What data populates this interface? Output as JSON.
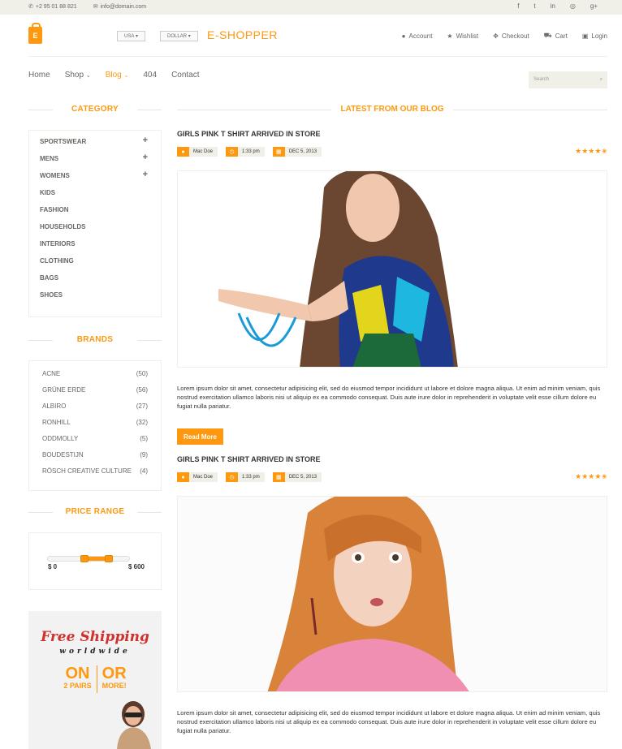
{
  "topbar": {
    "phone": "+2 95 01 88 821",
    "email": "info@domain.com",
    "social": [
      "f",
      "t",
      "in",
      "◎",
      "g+"
    ]
  },
  "header": {
    "logo": "E-SHOPPER",
    "country": "USA",
    "currency": "DOLLAR",
    "account": [
      "Account",
      "Wishlist",
      "Checkout",
      "Cart",
      "Login"
    ]
  },
  "nav": {
    "items": [
      "Home",
      "Shop",
      "Blog",
      "404",
      "Contact"
    ],
    "search_placeholder": "Search"
  },
  "sidebar": {
    "category_title": "CATEGORY",
    "categories": [
      {
        "label": "SPORTSWEAR",
        "expand": "+"
      },
      {
        "label": "MENS",
        "expand": "+"
      },
      {
        "label": "WOMENS",
        "expand": "+"
      },
      {
        "label": "KIDS"
      },
      {
        "label": "FASHION"
      },
      {
        "label": "HOUSEHOLDS"
      },
      {
        "label": "INTERIORS"
      },
      {
        "label": "CLOTHING"
      },
      {
        "label": "BAGS"
      },
      {
        "label": "SHOES"
      }
    ],
    "brands_title": "BRANDS",
    "brands": [
      {
        "name": "ACNE",
        "count": "(50)"
      },
      {
        "name": "GRÜNE ERDE",
        "count": "(56)"
      },
      {
        "name": "ALBIRO",
        "count": "(27)"
      },
      {
        "name": "RONHILL",
        "count": "(32)"
      },
      {
        "name": "ODDMOLLY",
        "count": "(5)"
      },
      {
        "name": "BOUDESTIJN",
        "count": "(9)"
      },
      {
        "name": "RÖSCH CREATIVE CULTURE",
        "count": "(4)"
      }
    ],
    "price_title": "PRICE RANGE",
    "price_min": "$ 0",
    "price_max": "$ 600",
    "ad": {
      "line1": "Free Shipping",
      "line2": "worldwide",
      "on": "ON",
      "pairs": "2 PAIRS",
      "or": "OR",
      "more": "MORE!"
    }
  },
  "main": {
    "title": "LATEST FROM OUR BLOG",
    "posts": [
      {
        "title": "GIRLS PINK T SHIRT ARRIVED IN STORE",
        "author": "Mac Doe",
        "time": "1:33 pm",
        "date": "DEC 5, 2013",
        "stars": "★★★★✬",
        "body": "Lorem ipsum dolor sit amet, consectetur adipisicing elit, sed do eiusmod tempor incididunt ut labore et dolore magna aliqua. Ut enim ad minim veniam, quis nostrud exercitation ullamco laboris nisi ut aliquip ex ea commodo consequat. Duis aute irure dolor in reprehenderit in voluptate velit esse cillum dolore eu fugiat nulla pariatur.",
        "read_more": "Read More"
      },
      {
        "title": "GIRLS PINK T SHIRT ARRIVED IN STORE",
        "author": "Mac Doe",
        "time": "1:33 pm",
        "date": "DEC 5, 2013",
        "stars": "★★★★✬",
        "body": "Lorem ipsum dolor sit amet, consectetur adipisicing elit, sed do eiusmod tempor incididunt ut labore et dolore magna aliqua. Ut enim ad minim veniam, quis nostrud exercitation ullamco laboris nisi ut aliquip ex ea commodo consequat. Duis aute irure dolor in reprehenderit in voluptate velit esse cillum dolore eu fugiat nulla pariatur."
      }
    ]
  },
  "colors": {
    "accent": "#FE980F",
    "text": "#696763",
    "bg": "#f0f0e9"
  }
}
